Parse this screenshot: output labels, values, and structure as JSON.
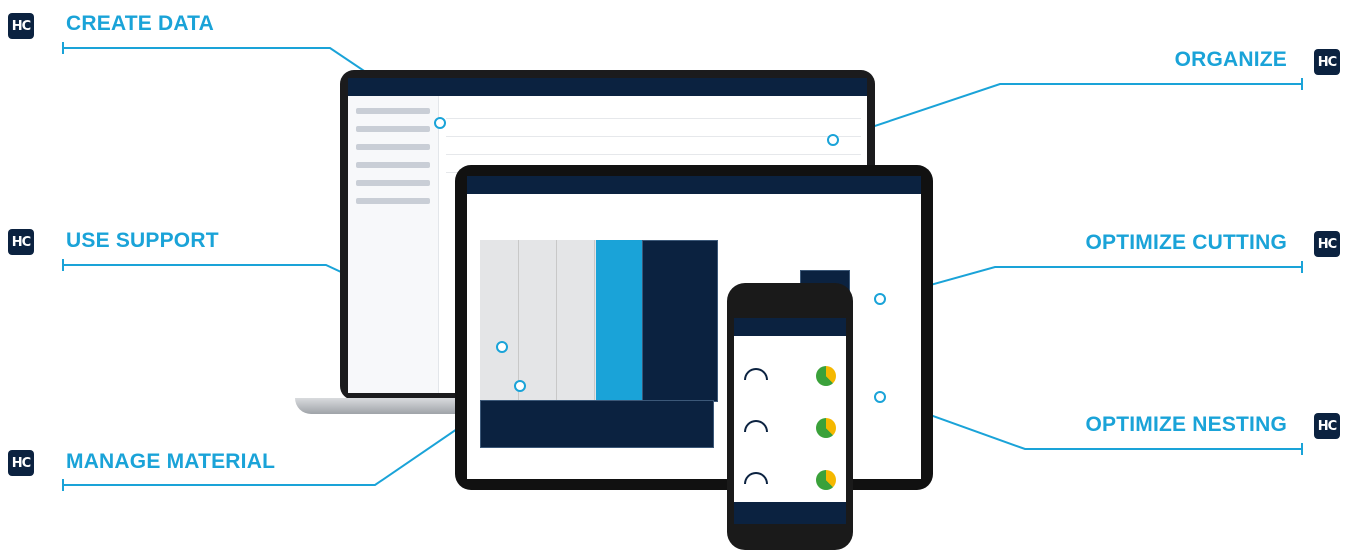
{
  "brand": {
    "logo_text": "HC",
    "accent": "#1aa3d8",
    "navy": "#0b2240"
  },
  "callouts": {
    "create_data": "CREATE DATA",
    "organize": "ORGANIZE",
    "use_support": "USE SUPPORT",
    "optimize_cutting": "OPTIMIZE CUTTING",
    "manage_material": "MANAGE MATERIAL",
    "optimize_nesting": "OPTIMIZE NESTING"
  },
  "devices": {
    "laptop": "laptop-mockup",
    "tablet": "tablet-mockup",
    "phone": "phone-mockup"
  }
}
